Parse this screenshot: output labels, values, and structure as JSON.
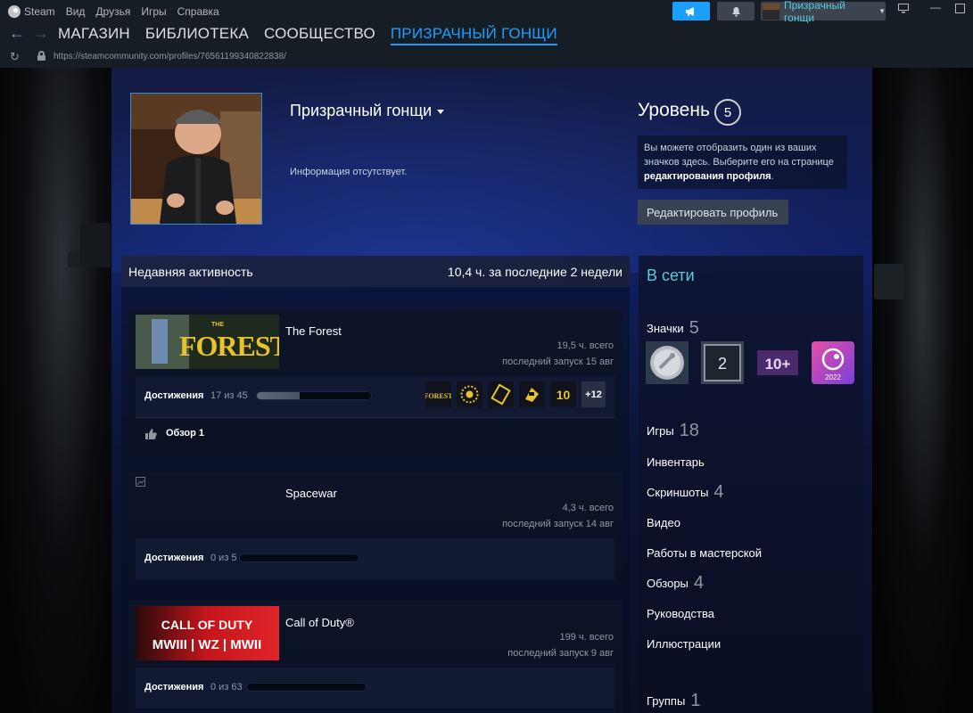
{
  "titlebar": {
    "menu": [
      "Steam",
      "Вид",
      "Друзья",
      "Игры",
      "Справка"
    ],
    "username": "Призрачный гонщи"
  },
  "nav": {
    "links": [
      "МАГАЗИН",
      "БИБЛИОТЕКА",
      "СООБЩЕСТВО",
      "ПРИЗРАЧНЫЙ ГОНЩИ"
    ],
    "active_index": 3
  },
  "url": "https://steamcommunity.com/profiles/76561199340822838/",
  "profile": {
    "persona_name": "Призрачный гонщи",
    "summary": "Информация отсутствует.",
    "level_label": "Уровень",
    "level": "5",
    "badge_hint_pre": "Вы можете отобразить один из ваших значков здесь. Выберите его на странице ",
    "badge_hint_link": "редактирования профиля",
    "badge_hint_post": ".",
    "edit_button": "Редактировать профиль"
  },
  "recent_activity": {
    "title": "Недавняя активность",
    "hours": "10,4 ч. за последние 2 недели",
    "games": [
      {
        "name": "The Forest",
        "hours_total": "19,5 ч. всего",
        "last_played": "последний запуск 15 авг",
        "ach_label": "Достижения",
        "ach_count": "17 из 45",
        "ach_progress": 0.378,
        "ach_more": "+12",
        "review": "Обзор 1"
      },
      {
        "name": "Spacewar",
        "hours_total": "4,3 ч. всего",
        "last_played": "последний запуск 14 авг",
        "ach_label": "Достижения",
        "ach_count": "0 из 5",
        "ach_progress": 0
      },
      {
        "name": "Call of Duty®",
        "hours_total": "199 ч. всего",
        "last_played": "последний запуск 9 авг",
        "ach_label": "Достижения",
        "ach_count": "0 из 63",
        "ach_progress": 0
      }
    ]
  },
  "sidebar": {
    "status": "В сети",
    "badges_label": "Значки",
    "badges_count": "5",
    "badge_2_text": "2",
    "badge_3_text": "10+",
    "badge_4_text": "2022",
    "games_label": "Игры",
    "games_count": "18",
    "inventory": "Инвентарь",
    "screenshots_label": "Скриншоты",
    "screenshots_count": "4",
    "videos": "Видео",
    "workshop": "Работы в мастерской",
    "reviews_label": "Обзоры",
    "reviews_count": "4",
    "guides": "Руководства",
    "artwork": "Иллюстрации",
    "groups_label": "Группы",
    "groups_count": "1"
  },
  "colors": {
    "accent": "#1a9fff",
    "online": "#57cbde"
  }
}
